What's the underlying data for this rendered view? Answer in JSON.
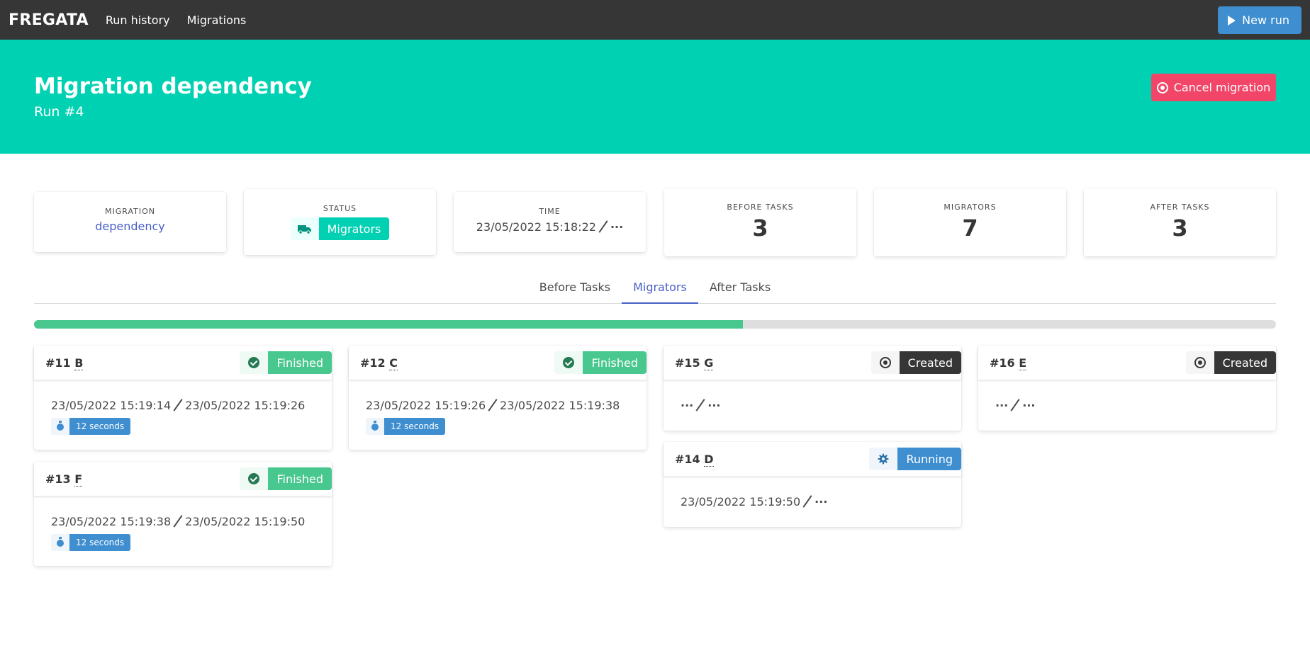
{
  "navbar": {
    "brand": "FREGATA",
    "links": [
      "Run history",
      "Migrations"
    ],
    "new_run_label": "New run"
  },
  "hero": {
    "title": "Migration dependency",
    "subtitle": "Run #4",
    "cancel_label": "Cancel migration"
  },
  "stats": {
    "migration": {
      "heading": "Migration",
      "value": "dependency"
    },
    "status": {
      "heading": "Status",
      "value": "Migrators",
      "icon": "truck-icon"
    },
    "time": {
      "heading": "Time",
      "start": "23/05/2022 15:18:22",
      "end": "···"
    },
    "before_tasks": {
      "heading": "Before tasks",
      "value": "3"
    },
    "migrators": {
      "heading": "Migrators",
      "value": "7"
    },
    "after_tasks": {
      "heading": "After tasks",
      "value": "3"
    }
  },
  "tabs": [
    {
      "label": "Before Tasks",
      "active": false
    },
    {
      "label": "Migrators",
      "active": true
    },
    {
      "label": "After Tasks",
      "active": false
    }
  ],
  "progress": {
    "fraction": 0.571
  },
  "colors": {
    "finished": "#48c78e",
    "created": "#363636",
    "running": "#3e8ed0",
    "hero": "#00d1b2",
    "danger": "#f14668"
  },
  "cards": [
    {
      "id": "#11",
      "name": "B",
      "status": "Finished",
      "icon": "check-circle-icon",
      "start": "23/05/2022 15:19:14",
      "end": "23/05/2022 15:19:26",
      "duration": "12 seconds"
    },
    {
      "id": "#12",
      "name": "C",
      "status": "Finished",
      "icon": "check-circle-icon",
      "start": "23/05/2022 15:19:26",
      "end": "23/05/2022 15:19:38",
      "duration": "12 seconds"
    },
    {
      "id": "#15",
      "name": "G",
      "status": "Created",
      "icon": "record-icon",
      "start": "···",
      "end": "···",
      "duration": ""
    },
    {
      "id": "#16",
      "name": "E",
      "status": "Created",
      "icon": "record-icon",
      "start": "···",
      "end": "···",
      "duration": ""
    },
    {
      "id": "#13",
      "name": "F",
      "status": "Finished",
      "icon": "check-circle-icon",
      "start": "23/05/2022 15:19:38",
      "end": "23/05/2022 15:19:50",
      "duration": "12 seconds"
    },
    {
      "id": "#14",
      "name": "D",
      "status": "Running",
      "icon": "gear-icon",
      "start": "23/05/2022 15:19:50",
      "end": "···",
      "duration": ""
    }
  ]
}
